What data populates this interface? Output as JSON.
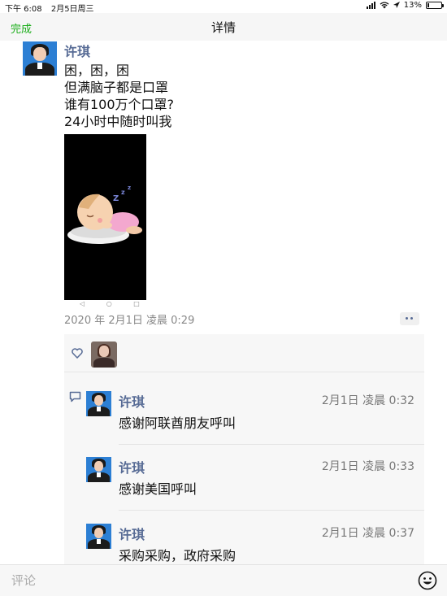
{
  "status_bar": {
    "time": "下午 6:08",
    "date": "2月5日周三",
    "battery": "13%",
    "battery_level": 0.13
  },
  "nav": {
    "done_label": "完成",
    "title": "详情"
  },
  "post": {
    "author": "许琪",
    "lines": [
      "困，困，困",
      "但满脑子都是口罩",
      "谁有100万个口罩?",
      "24小时中随时叫我"
    ],
    "image": {
      "icon": "sleeping-baby-sticker",
      "sleep_text": "Z z z"
    },
    "image_nav": "◁ ○ □",
    "timestamp": "2020 年 2月1日 凌晨 0:29"
  },
  "comments": [
    {
      "author": "许琪",
      "time": "2月1日 凌晨 0:32",
      "text": "感谢阿联酋朋友呼叫"
    },
    {
      "author": "许琪",
      "time": "2月1日 凌晨 0:33",
      "text": "感谢美国呼叫"
    },
    {
      "author": "许琪",
      "time": "2月1日 凌晨 0:37",
      "text": "采购采购，政府采购"
    }
  ],
  "comment_input": {
    "placeholder": "评论"
  },
  "colors": {
    "accent": "#1aad19",
    "name": "#576b95"
  }
}
